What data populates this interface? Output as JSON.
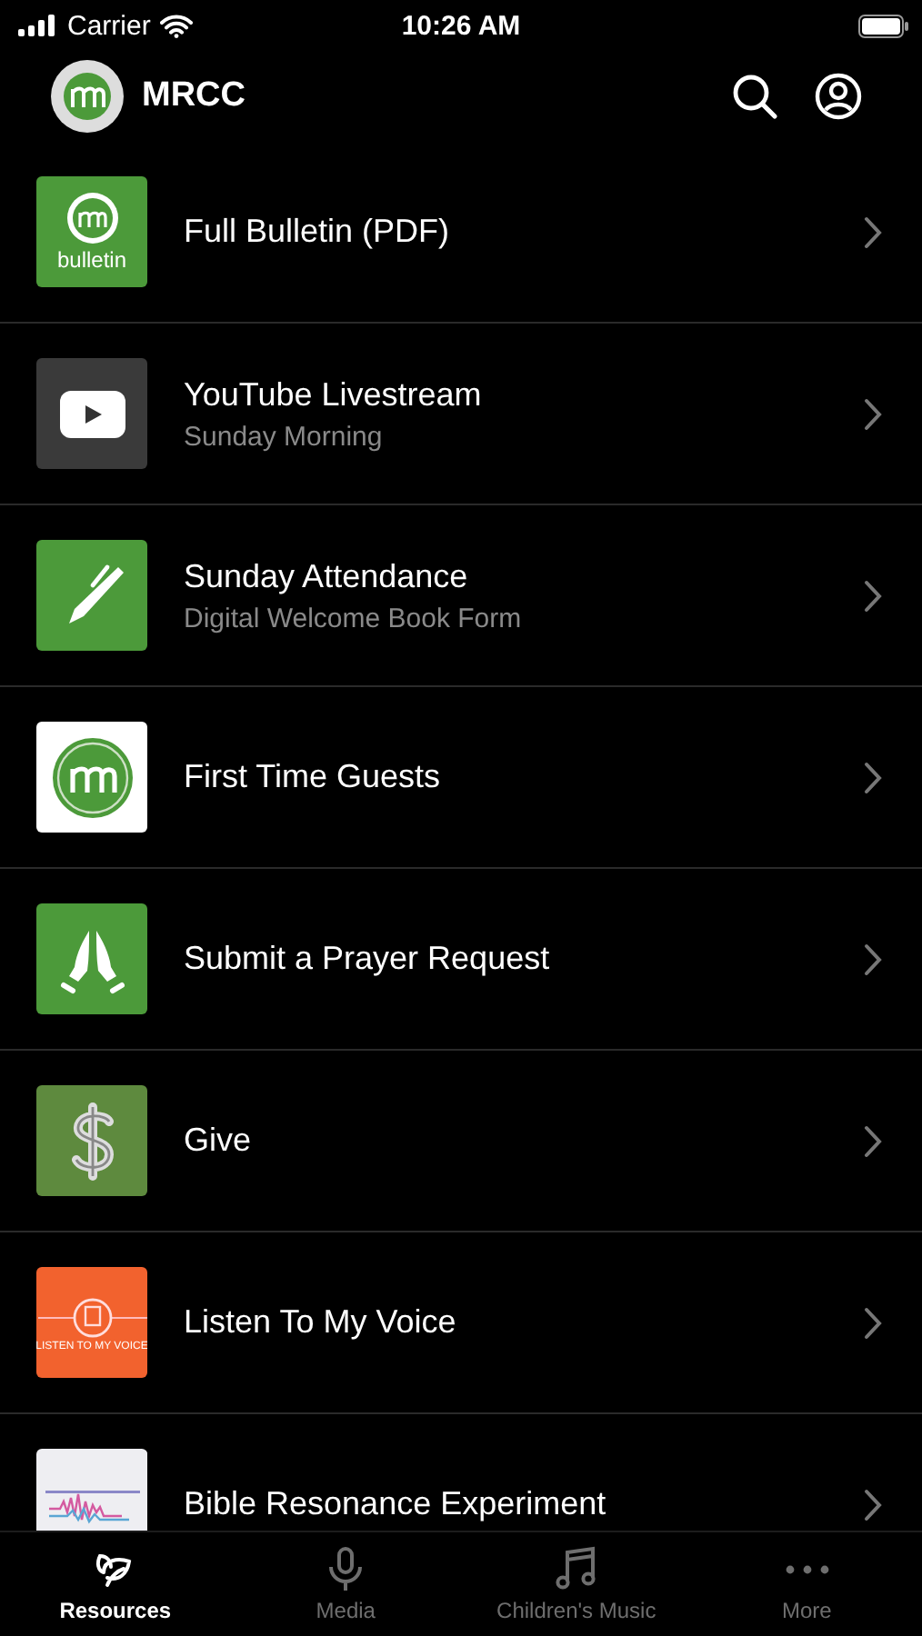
{
  "status_bar": {
    "carrier": "Carrier",
    "time": "10:26 AM"
  },
  "header": {
    "title": "MRCC"
  },
  "items": [
    {
      "title": "Full Bulletin (PDF)",
      "kind": "bulletin",
      "thumb_text": "bulletin"
    },
    {
      "title": "YouTube Livestream",
      "subtitle": "Sunday Morning",
      "kind": "video"
    },
    {
      "title": "Sunday Attendance",
      "subtitle": "Digital Welcome Book Form",
      "kind": "pen"
    },
    {
      "title": "First Time Guests",
      "kind": "logo"
    },
    {
      "title": "Submit a Prayer Request",
      "kind": "prayer"
    },
    {
      "title": "Give",
      "kind": "dollar"
    },
    {
      "title": "Listen To My Voice",
      "kind": "listen",
      "thumb_text": "LISTEN TO MY VOICE"
    },
    {
      "title": "Bible Resonance Experiment",
      "kind": "picture"
    }
  ],
  "tabs": [
    {
      "label": "Resources",
      "selected": true
    },
    {
      "label": "Media",
      "selected": false
    },
    {
      "label": "Children's Music",
      "selected": false
    },
    {
      "label": "More",
      "selected": false
    }
  ]
}
